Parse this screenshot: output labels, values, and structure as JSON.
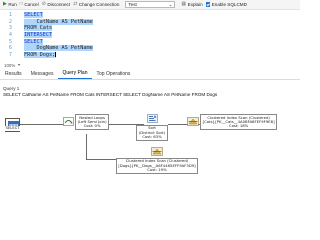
{
  "toolbar": {
    "run": "Run",
    "cancel": "Cancel",
    "disconnect": "Disconnect",
    "change_connection": "Change Connection",
    "database": "Test",
    "explain": "Explain",
    "sqlcmd": "Enable SQLCMD"
  },
  "editor": {
    "lines": [
      {
        "num": "1",
        "text": "SELECT"
      },
      {
        "num": "2",
        "text": "    CatName AS PetName"
      },
      {
        "num": "3",
        "text": "FROM Cats"
      },
      {
        "num": "4",
        "text": "INTERSECT"
      },
      {
        "num": "5",
        "text": "SELECT"
      },
      {
        "num": "6",
        "text": "    DogName AS PetName"
      },
      {
        "num": "7",
        "text": "FROM Dogs;"
      }
    ],
    "zoom": "100%"
  },
  "results_tabs": [
    "Results",
    "Messages",
    "Query Plan",
    "Top Operations"
  ],
  "active_tab": "Query Plan",
  "query": {
    "title": "Query 1",
    "text": "SELECT CatName AS PetName FROM Cats INTERSECT SELECT DogName AS PetName FROM Dogs"
  },
  "plan": {
    "select": "SELECT",
    "nested_loops": {
      "name": "Nested Loops",
      "detail": "(Left Semi Join)",
      "cost": "Cost: 0%"
    },
    "sort": {
      "name": "Sort",
      "detail": "(Distinct Sort)",
      "cost": "Cost: 63%"
    },
    "scan_cats": {
      "name": "Clustered Index Scan (Clustered)",
      "detail": "[Cats].[PK__Cats__4A0BFA8FEF9F9E8]",
      "cost": "Cost: 18%"
    },
    "scan_dogs": {
      "name": "Clustered Index Scan (Clustered)",
      "detail": "[Dogs].[PK__Dogs__A6F4465EFF9AF3D9]",
      "cost": "Cost: 19%"
    }
  }
}
